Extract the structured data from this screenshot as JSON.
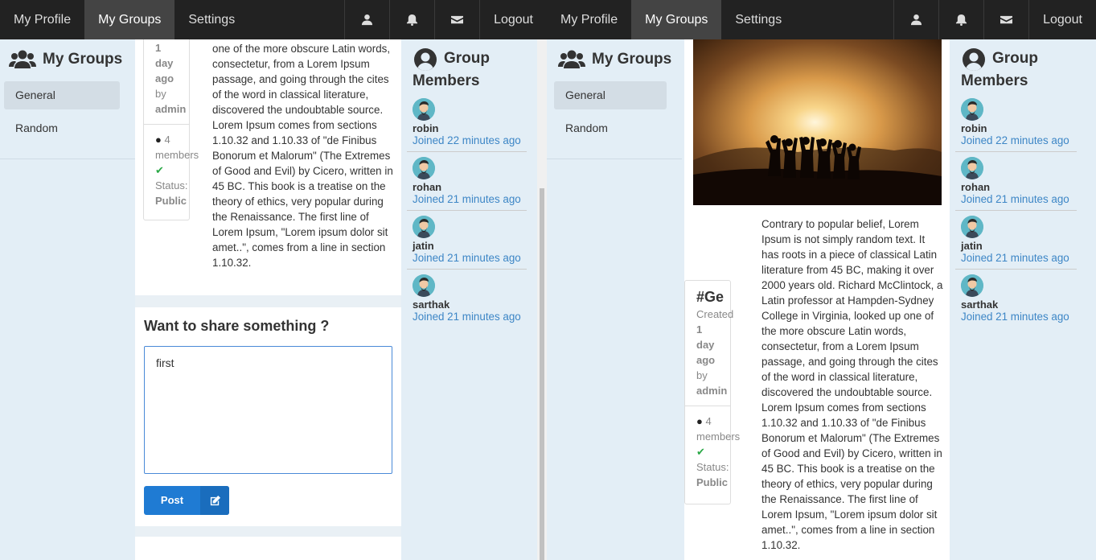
{
  "navbar": {
    "my_profile": "My Profile",
    "my_groups": "My Groups",
    "settings": "Settings",
    "logout": "Logout",
    "icons": [
      "user-icon",
      "bell-icon",
      "envelope-icon"
    ]
  },
  "sidebar": {
    "title": "My Groups",
    "items": [
      {
        "label": "General"
      },
      {
        "label": "Random"
      }
    ]
  },
  "post": {
    "group_tag": "#Ge",
    "created_label": "Created",
    "created_num": "1",
    "created_day": "day",
    "created_ago": "ago",
    "by": "by",
    "author": "admin",
    "members_count": "4",
    "members_label": "members",
    "status_label": "Status:",
    "status_value": "Public",
    "text_full": "Contrary to popular belief, Lorem Ipsum is not simply random text. It has roots in a piece of classical Latin literature from 45 BC, making it over 2000 years old. Richard McClintock, a Latin professor at Hampden-Sydney College in Virginia, looked up one of the more obscure Latin words, consectetur, from a Lorem Ipsum passage, and going through the cites of the word in classical literature, discovered the undoubtable source. Lorem Ipsum comes from sections 1.10.32 and 1.10.33 of \"de Finibus Bonorum et Malorum\" (The Extremes of Good and Evil) by Cicero, written in 45 BC. This book is a treatise on the theory of ethics, very popular during the Renaissance. The first line of Lorem Ipsum, \"Lorem ipsum dolor sit amet..\", comes from a line in section 1.10.32.",
    "text_tail": "one of the more obscure Latin words, consectetur, from a Lorem Ipsum passage, and going through the cites of the word in classical literature, discovered the undoubtable source. Lorem Ipsum comes from sections 1.10.32 and 1.10.33 of \"de Finibus Bonorum et Malorum\" (The Extremes of Good and Evil) by Cicero, written in 45 BC. This book is a treatise on the theory of ethics, very popular during the Renaissance. The first line of Lorem Ipsum, \"Lorem ipsum dolor sit amet..\", comes from a line in section 1.10.32."
  },
  "share": {
    "title": "Want to share something ?",
    "value": "first",
    "button": "Post",
    "button_icon": "edit-icon"
  },
  "members": {
    "title_line1": "Group",
    "title_line2": "Members",
    "list": [
      {
        "name": "robin",
        "joined": "Joined 22 minutes ago"
      },
      {
        "name": "rohan",
        "joined": "Joined 21 minutes ago"
      },
      {
        "name": "jatin",
        "joined": "Joined 21 minutes ago"
      },
      {
        "name": "sarthak",
        "joined": "Joined 21 minutes ago"
      }
    ]
  },
  "colors": {
    "navbar": "#222222",
    "active_nav": "#444444",
    "link": "#3d86c6",
    "button": "#1f7bd3",
    "status_check": "#2aa846"
  }
}
